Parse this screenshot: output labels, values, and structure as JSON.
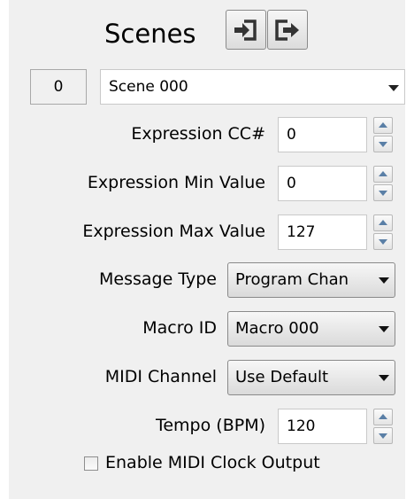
{
  "header": {
    "title": "Scenes"
  },
  "scene": {
    "index": "0",
    "selected": "Scene 000"
  },
  "fields": {
    "expression_cc": {
      "label": "Expression CC#",
      "value": "0"
    },
    "expression_min": {
      "label": "Expression Min Value",
      "value": "0"
    },
    "expression_max": {
      "label": "Expression Max Value",
      "value": "127"
    },
    "message_type": {
      "label": "Message Type",
      "value": "Program Chan"
    },
    "macro_id": {
      "label": "Macro ID",
      "value": "Macro 000"
    },
    "midi_channel": {
      "label": "MIDI Channel",
      "value": "Use Default"
    },
    "tempo": {
      "label": "Tempo (BPM)",
      "value": "120"
    }
  },
  "midi_clock": {
    "label": "Enable MIDI Clock Output",
    "checked": false
  },
  "icons": {
    "import": "import-icon",
    "export": "export-icon"
  }
}
